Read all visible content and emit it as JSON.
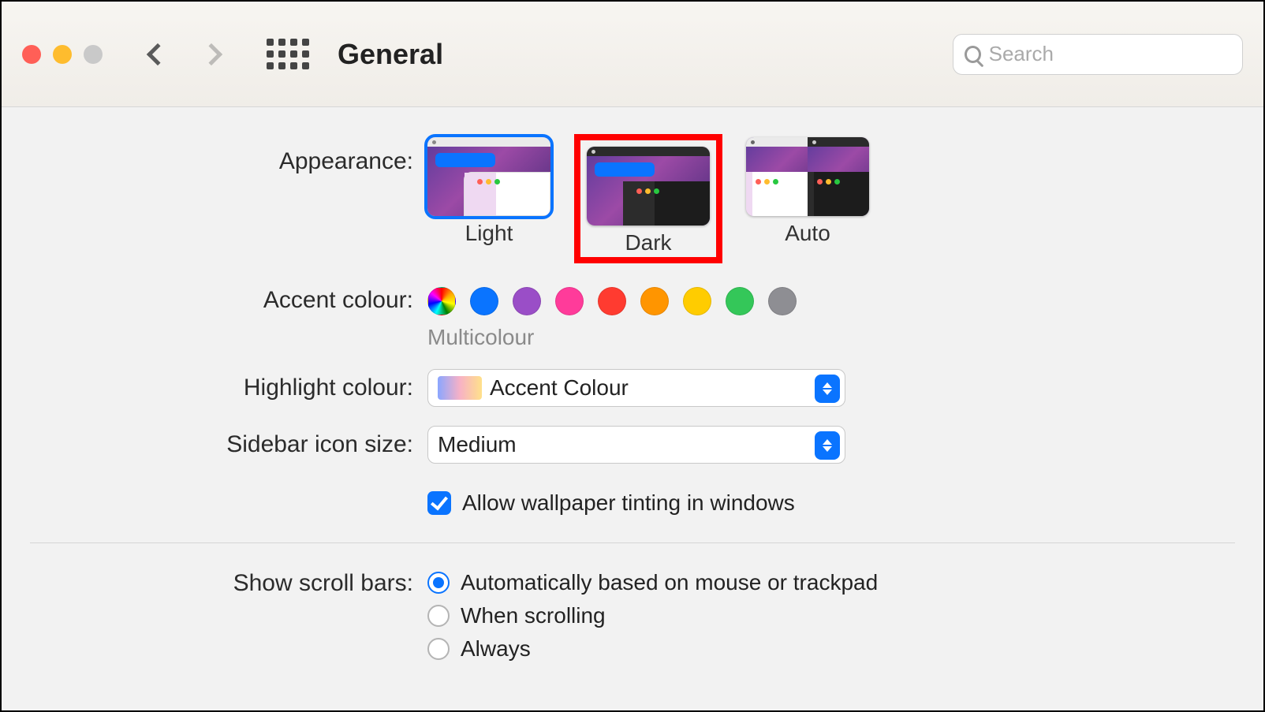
{
  "title": "General",
  "search": {
    "placeholder": "Search"
  },
  "appearance": {
    "label": "Appearance:",
    "options": [
      {
        "id": "light",
        "label": "Light",
        "selected": true
      },
      {
        "id": "dark",
        "label": "Dark",
        "highlighted": true
      },
      {
        "id": "auto",
        "label": "Auto"
      }
    ]
  },
  "accent": {
    "label": "Accent colour:",
    "selected_name": "Multicolour",
    "colours": [
      {
        "id": "multicolour",
        "hex": "multicolour"
      },
      {
        "id": "blue",
        "hex": "#0a74ff"
      },
      {
        "id": "purple",
        "hex": "#9a4ec7"
      },
      {
        "id": "pink",
        "hex": "#ff3b9a"
      },
      {
        "id": "red",
        "hex": "#ff3b30"
      },
      {
        "id": "orange",
        "hex": "#ff9500"
      },
      {
        "id": "yellow",
        "hex": "#ffcc00"
      },
      {
        "id": "green",
        "hex": "#34c759"
      },
      {
        "id": "graphite",
        "hex": "#8e8e93"
      }
    ]
  },
  "highlight": {
    "label": "Highlight colour:",
    "value": "Accent Colour"
  },
  "sidebar_icon": {
    "label": "Sidebar icon size:",
    "value": "Medium"
  },
  "wallpaper_tint": {
    "checked": true,
    "label": "Allow wallpaper tinting in windows"
  },
  "scrollbars": {
    "label": "Show scroll bars:",
    "options": [
      {
        "id": "auto",
        "label": "Automatically based on mouse or trackpad",
        "checked": true
      },
      {
        "id": "when",
        "label": "When scrolling"
      },
      {
        "id": "always",
        "label": "Always"
      }
    ]
  }
}
